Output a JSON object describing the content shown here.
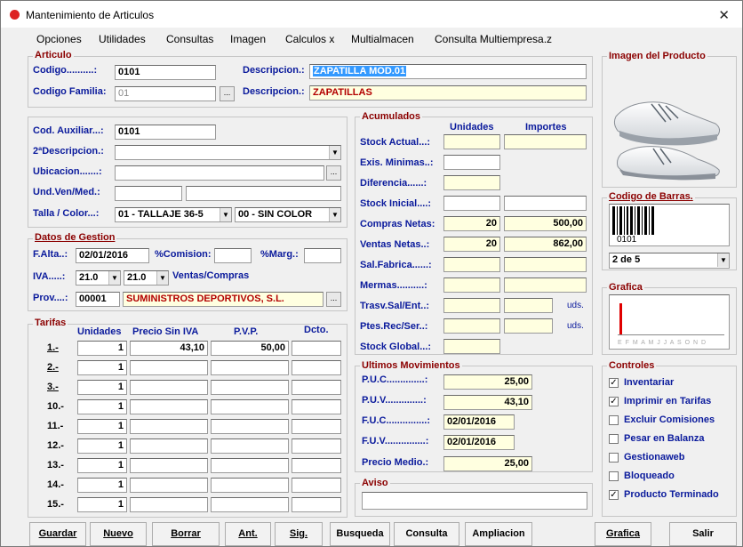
{
  "window": {
    "title": "Mantenimiento de Articulos",
    "close_glyph": "✕"
  },
  "menu": [
    "Opciones",
    "Utilidades",
    "Consultas",
    "Imagen",
    "Calculos x",
    "Multialmacen",
    "Consulta Multiempresa.z"
  ],
  "articulo": {
    "group_title": "Articulo",
    "codigo_label": "Codigo..........:",
    "codigo_value": "0101",
    "descripcion_label": "Descripcion.:",
    "descripcion_value": "ZAPATILLA MOD.01",
    "codigo_familia_label": "Codigo Familia:",
    "codigo_familia_value": "01",
    "familia_descripcion_label": "Descripcion.:",
    "familia_descripcion_value": "ZAPATILLAS",
    "browse_glyph": "..."
  },
  "detalle": {
    "cod_auxiliar_label": "Cod. Auxiliar...:",
    "cod_auxiliar_value": "0101",
    "descripcion2_label": "2ªDescripcion.:",
    "ubicacion_label": "Ubicacion.......:",
    "und_ven_label": "Und.Ven/Med.:",
    "talla_label": "Talla / Color...:",
    "talla_value": "01 - TALLAJE 36-5",
    "color_value": "00 - SIN COLOR"
  },
  "gestion": {
    "group_title": "Datos de Gestion",
    "falta_label": "F.Alta..:",
    "falta_value": "02/01/2016",
    "comision_label": "%Comision:",
    "marg_label": "%Marg.:",
    "iva_label": "IVA.....:",
    "iva1": "21.0",
    "iva2": "21.0",
    "ventas_compras_label": "Ventas/Compras",
    "prov_label": "Prov....:",
    "prov_code": "00001",
    "prov_name": "SUMINISTROS DEPORTIVOS, S.L."
  },
  "tarifas": {
    "group_title": "Tarifas",
    "headers": [
      "Unidades",
      "Precio Sin IVA",
      "P.V.P.",
      "Dcto."
    ],
    "rows": [
      {
        "label": "1.-",
        "units": "1",
        "precio": "43,10",
        "pvp": "50,00"
      },
      {
        "label": "2.-",
        "units": "1",
        "precio": "",
        "pvp": ""
      },
      {
        "label": "3.-",
        "units": "1",
        "precio": "",
        "pvp": ""
      },
      {
        "label": "10.-",
        "units": "1",
        "precio": "",
        "pvp": ""
      },
      {
        "label": "11.-",
        "units": "1",
        "precio": "",
        "pvp": ""
      },
      {
        "label": "12.-",
        "units": "1",
        "precio": "",
        "pvp": ""
      },
      {
        "label": "13.-",
        "units": "1",
        "precio": "",
        "pvp": ""
      },
      {
        "label": "14.-",
        "units": "1",
        "precio": "",
        "pvp": ""
      },
      {
        "label": "15.-",
        "units": "1",
        "precio": "",
        "pvp": ""
      }
    ]
  },
  "acumulados": {
    "group_title": "Acumulados",
    "col_unidades": "Unidades",
    "col_importes": "Importes",
    "stock_actual": "Stock Actual...:",
    "exis_minimas": "Exis. Minimas..:",
    "diferencia": "Diferencia......:",
    "stock_inicial": "Stock Inicial....:",
    "compras_netas": "Compras Netas:",
    "compras_unidades": "20",
    "compras_importes": "500,00",
    "ventas_netas": "Ventas Netas..:",
    "ventas_unidades": "20",
    "ventas_importes": "862,00",
    "sal_fabrica": "Sal.Fabrica......:",
    "mermas": "Mermas..........:",
    "trasv": "Trasv.Sal/Ent..:",
    "ptes": "Ptes.Rec/Ser..:",
    "stock_global": "Stock Global...:",
    "uds": "uds."
  },
  "movimientos": {
    "group_title": "Ultimos Movimientos",
    "puc_label": "P.U.C..............:",
    "puc_value": "25,00",
    "puv_label": "P.U.V..............:",
    "puv_value": "43,10",
    "fuc_label": "F.U.C...............:",
    "fuc_value": "02/01/2016",
    "fuv_label": "F.U.V...............:",
    "fuv_value": "02/01/2016",
    "precio_medio_label": "Precio Medio.:",
    "precio_medio_value": "25,00"
  },
  "aviso": {
    "group_title": "Aviso"
  },
  "imagen": {
    "group_title": "Imagen del Producto"
  },
  "barras": {
    "group_title": "Codigo de Barras.",
    "code": "0101",
    "tipo": "2 de 5"
  },
  "grafica": {
    "group_title": "Grafica",
    "months": "E F M A M J J A S O N D"
  },
  "controles": {
    "group_title": "Controles",
    "items": [
      {
        "label": "Inventariar",
        "checked": true
      },
      {
        "label": "Imprimir en Tarifas",
        "checked": true
      },
      {
        "label": "Excluir Comisiones",
        "checked": false
      },
      {
        "label": "Pesar en Balanza",
        "checked": false
      },
      {
        "label": "Gestionaweb",
        "checked": false
      },
      {
        "label": "Bloqueado",
        "checked": false
      },
      {
        "label": "Producto Terminado",
        "checked": true
      }
    ]
  },
  "buttons": [
    "Guardar",
    "Nuevo",
    "Borrar",
    "Ant.",
    "Sig.",
    "Busqueda",
    "Consulta",
    "Ampliacion",
    "Grafica",
    "Salir"
  ],
  "colors": {
    "label_blue": "#0a1a9c",
    "group_red": "#8b0000",
    "highlight": "#3399ff",
    "field_yellow": "#ffffe0"
  }
}
